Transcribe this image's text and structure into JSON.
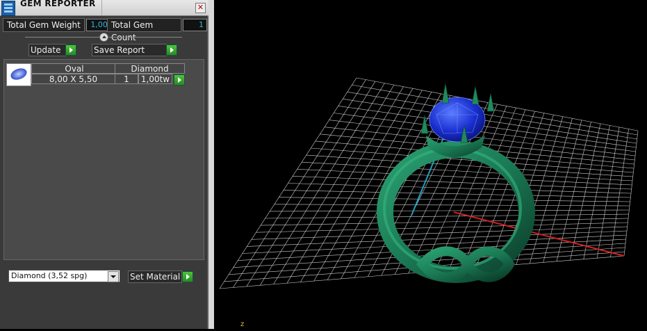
{
  "panel": {
    "title": "GEM REPORTER",
    "close_symbol": "✕",
    "total_gem_weight_label": "Total Gem Weight",
    "total_gem_weight_value": "1,00",
    "total_gem_count_label": "Total Gem Count",
    "total_gem_count_value": "1",
    "update_label": "Update",
    "save_report_label": "Save Report",
    "table": {
      "headers": [
        "Oval",
        "Diamond"
      ],
      "rows": [
        {
          "size": "8,00 X 5,50",
          "count": "1",
          "weight": "1,00tw"
        }
      ]
    },
    "material_select": "Diamond     (3,52 spg)",
    "set_material_label": "Set Material"
  },
  "viewport": {
    "axis_label": "z",
    "colors": {
      "ring": "#1a7a55",
      "gem": "#1a2fd0",
      "grid": "#cfcfcf",
      "x_axis": "#d02020",
      "y_axis": "#20a0c0"
    }
  }
}
